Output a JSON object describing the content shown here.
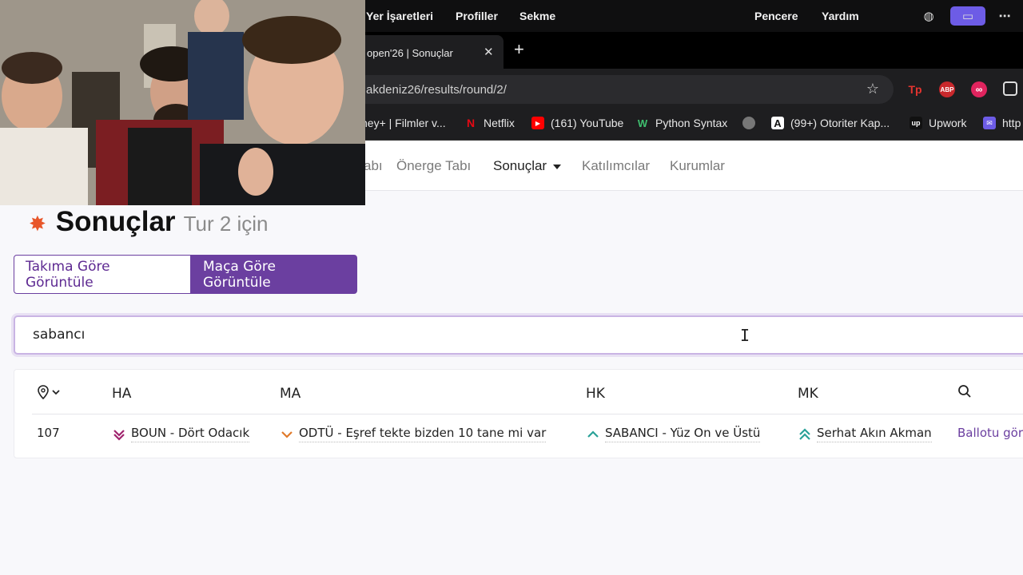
{
  "menubar": {
    "items": [
      "Yer İşaretleri",
      "Profiller",
      "Sekme",
      "Pencere",
      "Yardım"
    ]
  },
  "browser": {
    "tab_title": "open'26 | Sonuçlar",
    "tab_close": "✕",
    "new_tab": "+",
    "url": "akdeniz26/results/round/2/",
    "star": "☆",
    "extensions": [
      "Tp",
      "ABP",
      "∞"
    ],
    "bookmarks": [
      {
        "label": "ney+ | Filmler v..."
      },
      {
        "label": "Netflix",
        "icon": "N",
        "color": "#e50914"
      },
      {
        "label": "(161) YouTube",
        "icon": "▶",
        "color": "#ff0000"
      },
      {
        "label": "Python Syntax",
        "icon": "W",
        "color": "#1e1e20"
      },
      {
        "label": "",
        "icon": "🌐",
        "color": "#555"
      },
      {
        "label": "(99+) Otoriter Kap...",
        "icon": "A",
        "color": "#111"
      },
      {
        "label": "Upwork",
        "icon": "up",
        "color": "#111"
      },
      {
        "label": "http",
        "icon": "✉",
        "color": "#6d5ce6"
      }
    ]
  },
  "nav": {
    "partial": "abı",
    "items": [
      "Önerge Tabı",
      "Sonuçlar",
      "Katılımcılar",
      "Kurumlar"
    ],
    "active": "Sonuçlar"
  },
  "page": {
    "title": "Sonuçlar",
    "subtitle": "Tur 2 için",
    "view_team_label": "Takıma Göre Görüntüle",
    "view_match_label": "Maça Göre Görüntüle",
    "search_value": "sabancı",
    "table": {
      "headers": [
        "HA",
        "MA",
        "HK",
        "MK"
      ],
      "rows": [
        {
          "id": "107",
          "ha": "BOUN - Dört Odacık",
          "ma": "ODTÜ - Eşref tekte bizden 10 tane mi var",
          "hk": "SABANCI - Yüz On ve Üstü",
          "mk": "Serhat Akın Akman",
          "ballot": "Ballotu gör"
        }
      ]
    }
  },
  "colors": {
    "accent": "#6b3fa0",
    "rank_down_double": "#a0246e",
    "rank_down": "#e07a2b",
    "rank_up": "#2aa198"
  }
}
